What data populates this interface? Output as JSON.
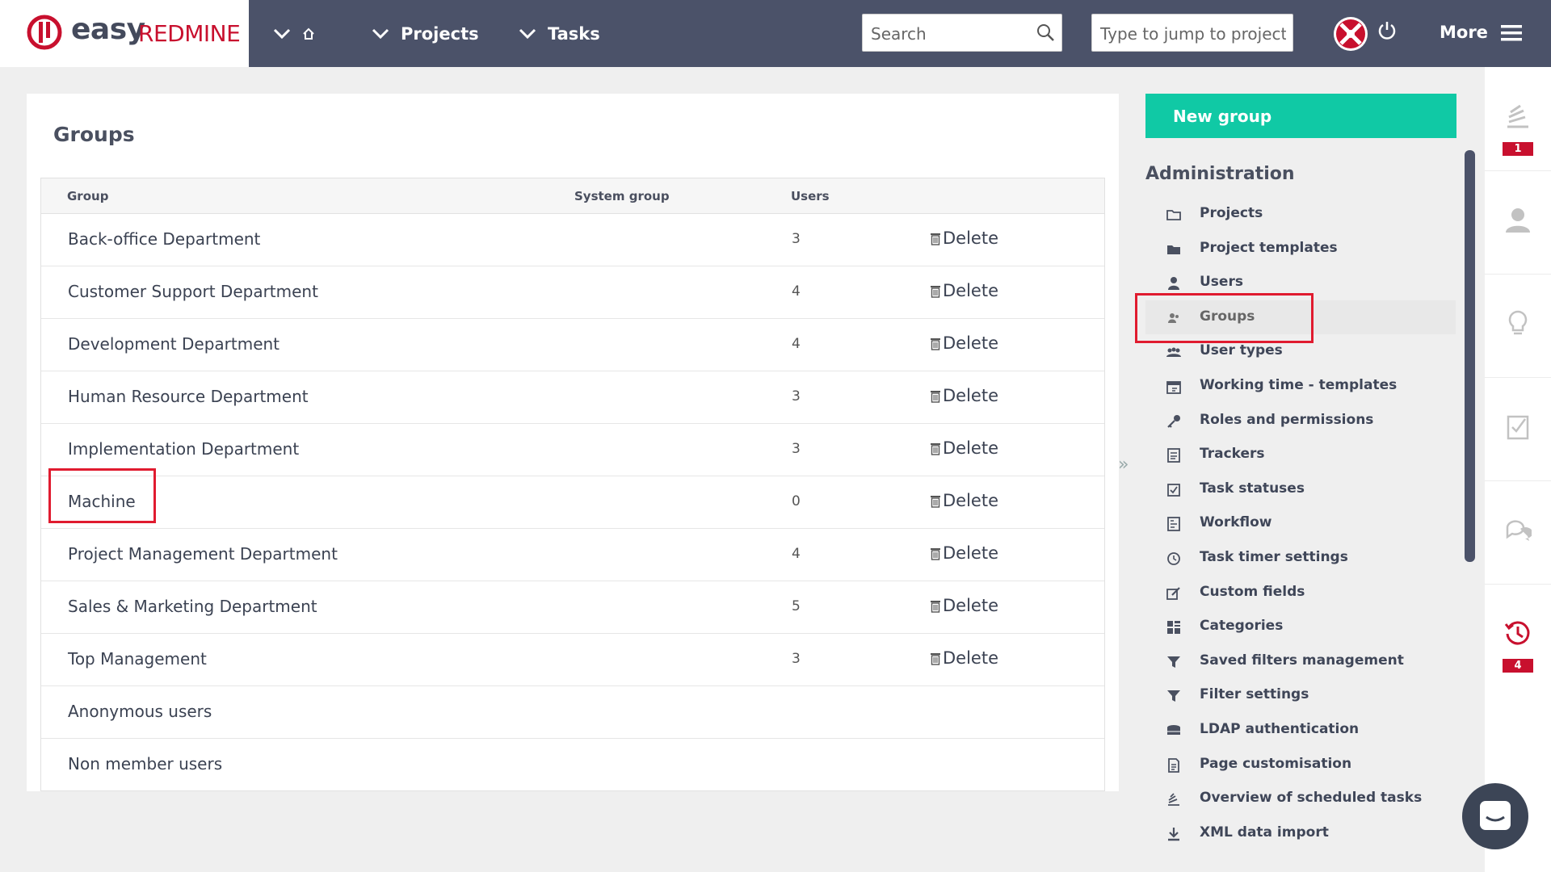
{
  "topbar": {
    "logo_easy": "easy",
    "logo_redmine": "REDMINE",
    "projects_label": "Projects",
    "tasks_label": "Tasks",
    "search_placeholder": "Search",
    "jump_placeholder": "Type to jump to project...",
    "more_label": "More"
  },
  "main": {
    "title": "Groups",
    "columns": {
      "group": "Group",
      "system_group": "System group",
      "users": "Users"
    },
    "rows": [
      {
        "name": "Back-office Department",
        "users": "3",
        "action": "Delete"
      },
      {
        "name": "Customer Support Department",
        "users": "4",
        "action": "Delete"
      },
      {
        "name": "Development Department",
        "users": "4",
        "action": "Delete"
      },
      {
        "name": "Human Resource Department",
        "users": "3",
        "action": "Delete"
      },
      {
        "name": "Implementation Department",
        "users": "3",
        "action": "Delete"
      },
      {
        "name": "Machine",
        "users": "0",
        "action": "Delete"
      },
      {
        "name": "Project Management Department",
        "users": "4",
        "action": "Delete"
      },
      {
        "name": "Sales & Marketing Department",
        "users": "5",
        "action": "Delete"
      },
      {
        "name": "Top Management",
        "users": "3",
        "action": "Delete"
      },
      {
        "name": "Anonymous users",
        "users": "",
        "action": ""
      },
      {
        "name": "Non member users",
        "users": "",
        "action": ""
      }
    ]
  },
  "sidebar": {
    "new_group_label": "New group",
    "admin_title": "Administration",
    "items": [
      {
        "label": "Projects",
        "icon": "folder-icon"
      },
      {
        "label": "Project templates",
        "icon": "folder-filled-icon"
      },
      {
        "label": "Users",
        "icon": "user-icon"
      },
      {
        "label": "Groups",
        "icon": "group-icon",
        "active": true
      },
      {
        "label": "User types",
        "icon": "user-types-icon"
      },
      {
        "label": "Working time - templates",
        "icon": "calendar-icon"
      },
      {
        "label": "Roles and permissions",
        "icon": "key-icon"
      },
      {
        "label": "Trackers",
        "icon": "tracker-icon"
      },
      {
        "label": "Task statuses",
        "icon": "checkbox-icon"
      },
      {
        "label": "Workflow",
        "icon": "workflow-icon"
      },
      {
        "label": "Task timer settings",
        "icon": "clock-icon"
      },
      {
        "label": "Custom fields",
        "icon": "edit-icon"
      },
      {
        "label": "Categories",
        "icon": "grid-icon"
      },
      {
        "label": "Saved filters management",
        "icon": "filter-icon"
      },
      {
        "label": "Filter settings",
        "icon": "filter-icon"
      },
      {
        "label": "LDAP authentication",
        "icon": "database-icon"
      },
      {
        "label": "Page customisation",
        "icon": "page-icon"
      },
      {
        "label": "Overview of scheduled tasks",
        "icon": "scheduled-icon"
      },
      {
        "label": "XML data import",
        "icon": "download-icon"
      }
    ]
  },
  "rail": {
    "activity_badge": "1",
    "timer_badge": "4"
  },
  "colors": {
    "topbar": "#4b5269",
    "accent": "#10c9a5",
    "brand_red": "#c8102e",
    "highlight": "#e01b2f"
  }
}
